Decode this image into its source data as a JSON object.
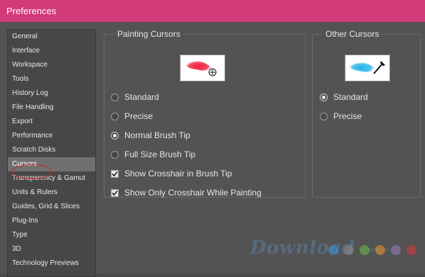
{
  "window": {
    "title": "Preferences"
  },
  "sidebar": {
    "selected": "Cursors",
    "items": [
      {
        "label": "General"
      },
      {
        "label": "Interface"
      },
      {
        "label": "Workspace"
      },
      {
        "label": "Tools"
      },
      {
        "label": "History Log"
      },
      {
        "label": "File Handling"
      },
      {
        "label": "Export"
      },
      {
        "label": "Performance"
      },
      {
        "label": "Scratch Disks"
      },
      {
        "label": "Cursors"
      },
      {
        "label": "Transparency & Gamut"
      },
      {
        "label": "Units & Rulers"
      },
      {
        "label": "Guides, Grid & Slices"
      },
      {
        "label": "Plug-Ins"
      },
      {
        "label": "Type"
      },
      {
        "label": "3D"
      },
      {
        "label": "Technology Previews"
      }
    ]
  },
  "painting_cursors": {
    "title": "Painting Cursors",
    "preview_icon": "red-brush-stroke-crosshair-icon",
    "preview_color": "#e8203a",
    "options": [
      {
        "label": "Standard",
        "type": "radio",
        "checked": false
      },
      {
        "label": "Precise",
        "type": "radio",
        "checked": false
      },
      {
        "label": "Normal Brush Tip",
        "type": "radio",
        "checked": true
      },
      {
        "label": "Full Size Brush Tip",
        "type": "radio",
        "checked": false
      },
      {
        "label": "Show Crosshair in Brush Tip",
        "type": "checkbox",
        "checked": true
      },
      {
        "label": "Show Only Crosshair While Painting",
        "type": "checkbox",
        "checked": true
      }
    ]
  },
  "other_cursors": {
    "title": "Other Cursors",
    "preview_icon": "cyan-brush-stroke-eyedropper-icon",
    "preview_color": "#2ab6e6",
    "options": [
      {
        "label": "Standard",
        "type": "radio",
        "checked": true
      },
      {
        "label": "Precise",
        "type": "radio",
        "checked": false
      }
    ]
  },
  "watermark": {
    "text": "Download",
    "suffix": ".com.vn"
  },
  "colors": {
    "titlebar": "#d23a79",
    "panel": "#535353",
    "sidebar": "#474747",
    "selected": "#707070"
  }
}
